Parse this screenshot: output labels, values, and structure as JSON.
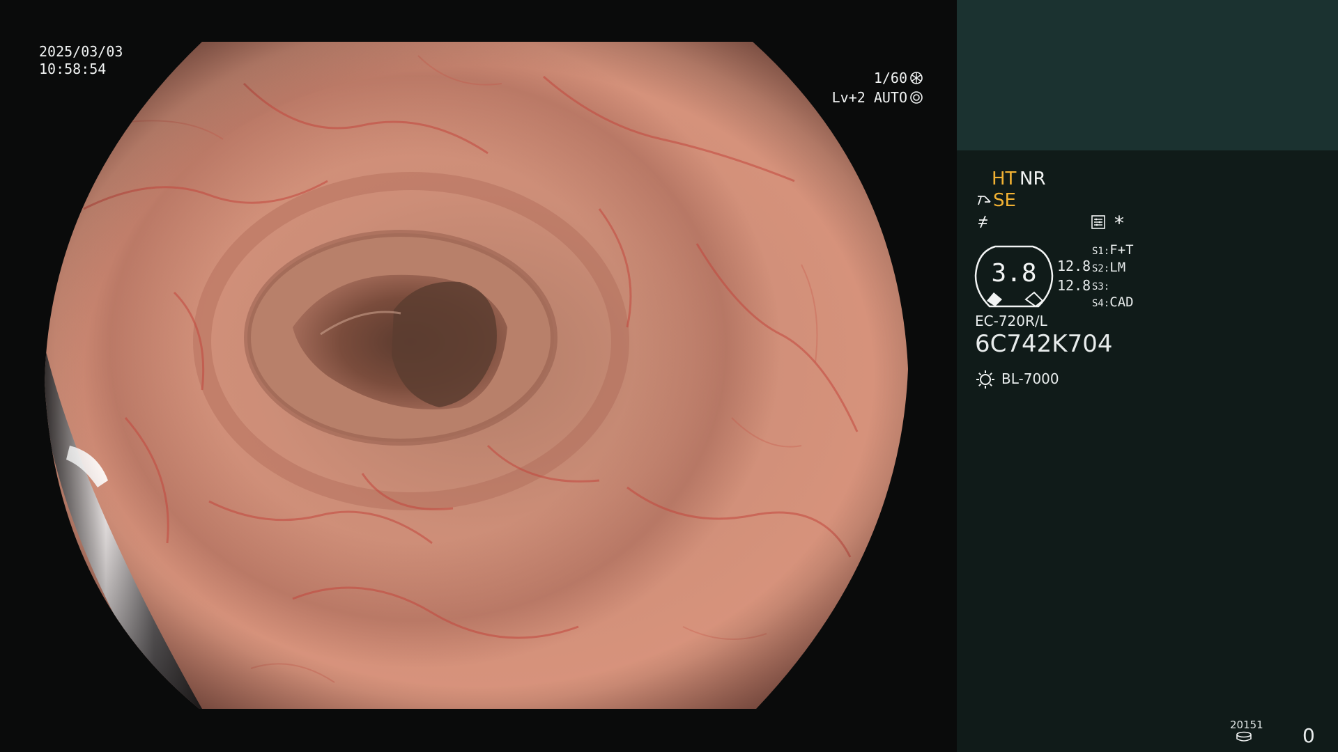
{
  "colors": {
    "background": "#0a0b0b",
    "panel": "#101b19",
    "panel_top": "#1b3230",
    "accent_orange": "#f2b233",
    "text": "#f2f4f4"
  },
  "overlay": {
    "date": "2025/03/03",
    "time": "10:58:54",
    "shutter": "1/60",
    "shutter_icon": "aperture-icon",
    "level": "Lv+2 AUTO",
    "level_icon": "iris-icon"
  },
  "panel": {
    "mode_ht": "HT",
    "mode_nr": "NR",
    "mode_se": "SE",
    "se_icon": "structure-enhancement-icon",
    "edge_icon": "edge-enhancement-icon",
    "menu_icon": "settings-list-icon",
    "asterisk": "*",
    "zoom_value": "3.8",
    "sub_value_1": "12.8",
    "sub_value_2": "12.8",
    "switches": [
      {
        "key": "S1:",
        "value": "F+T"
      },
      {
        "key": "S2:",
        "value": "LM"
      },
      {
        "key": "S3:",
        "value": ""
      },
      {
        "key": "S4:",
        "value": "CAD"
      }
    ],
    "scope_model": "EC-720R/L",
    "scope_serial": "6C742K704",
    "light_icon": "light-source-icon",
    "light_source": "BL-7000",
    "counter": "20151",
    "disk_icon": "storage-disk-icon",
    "capture_count": "0"
  }
}
